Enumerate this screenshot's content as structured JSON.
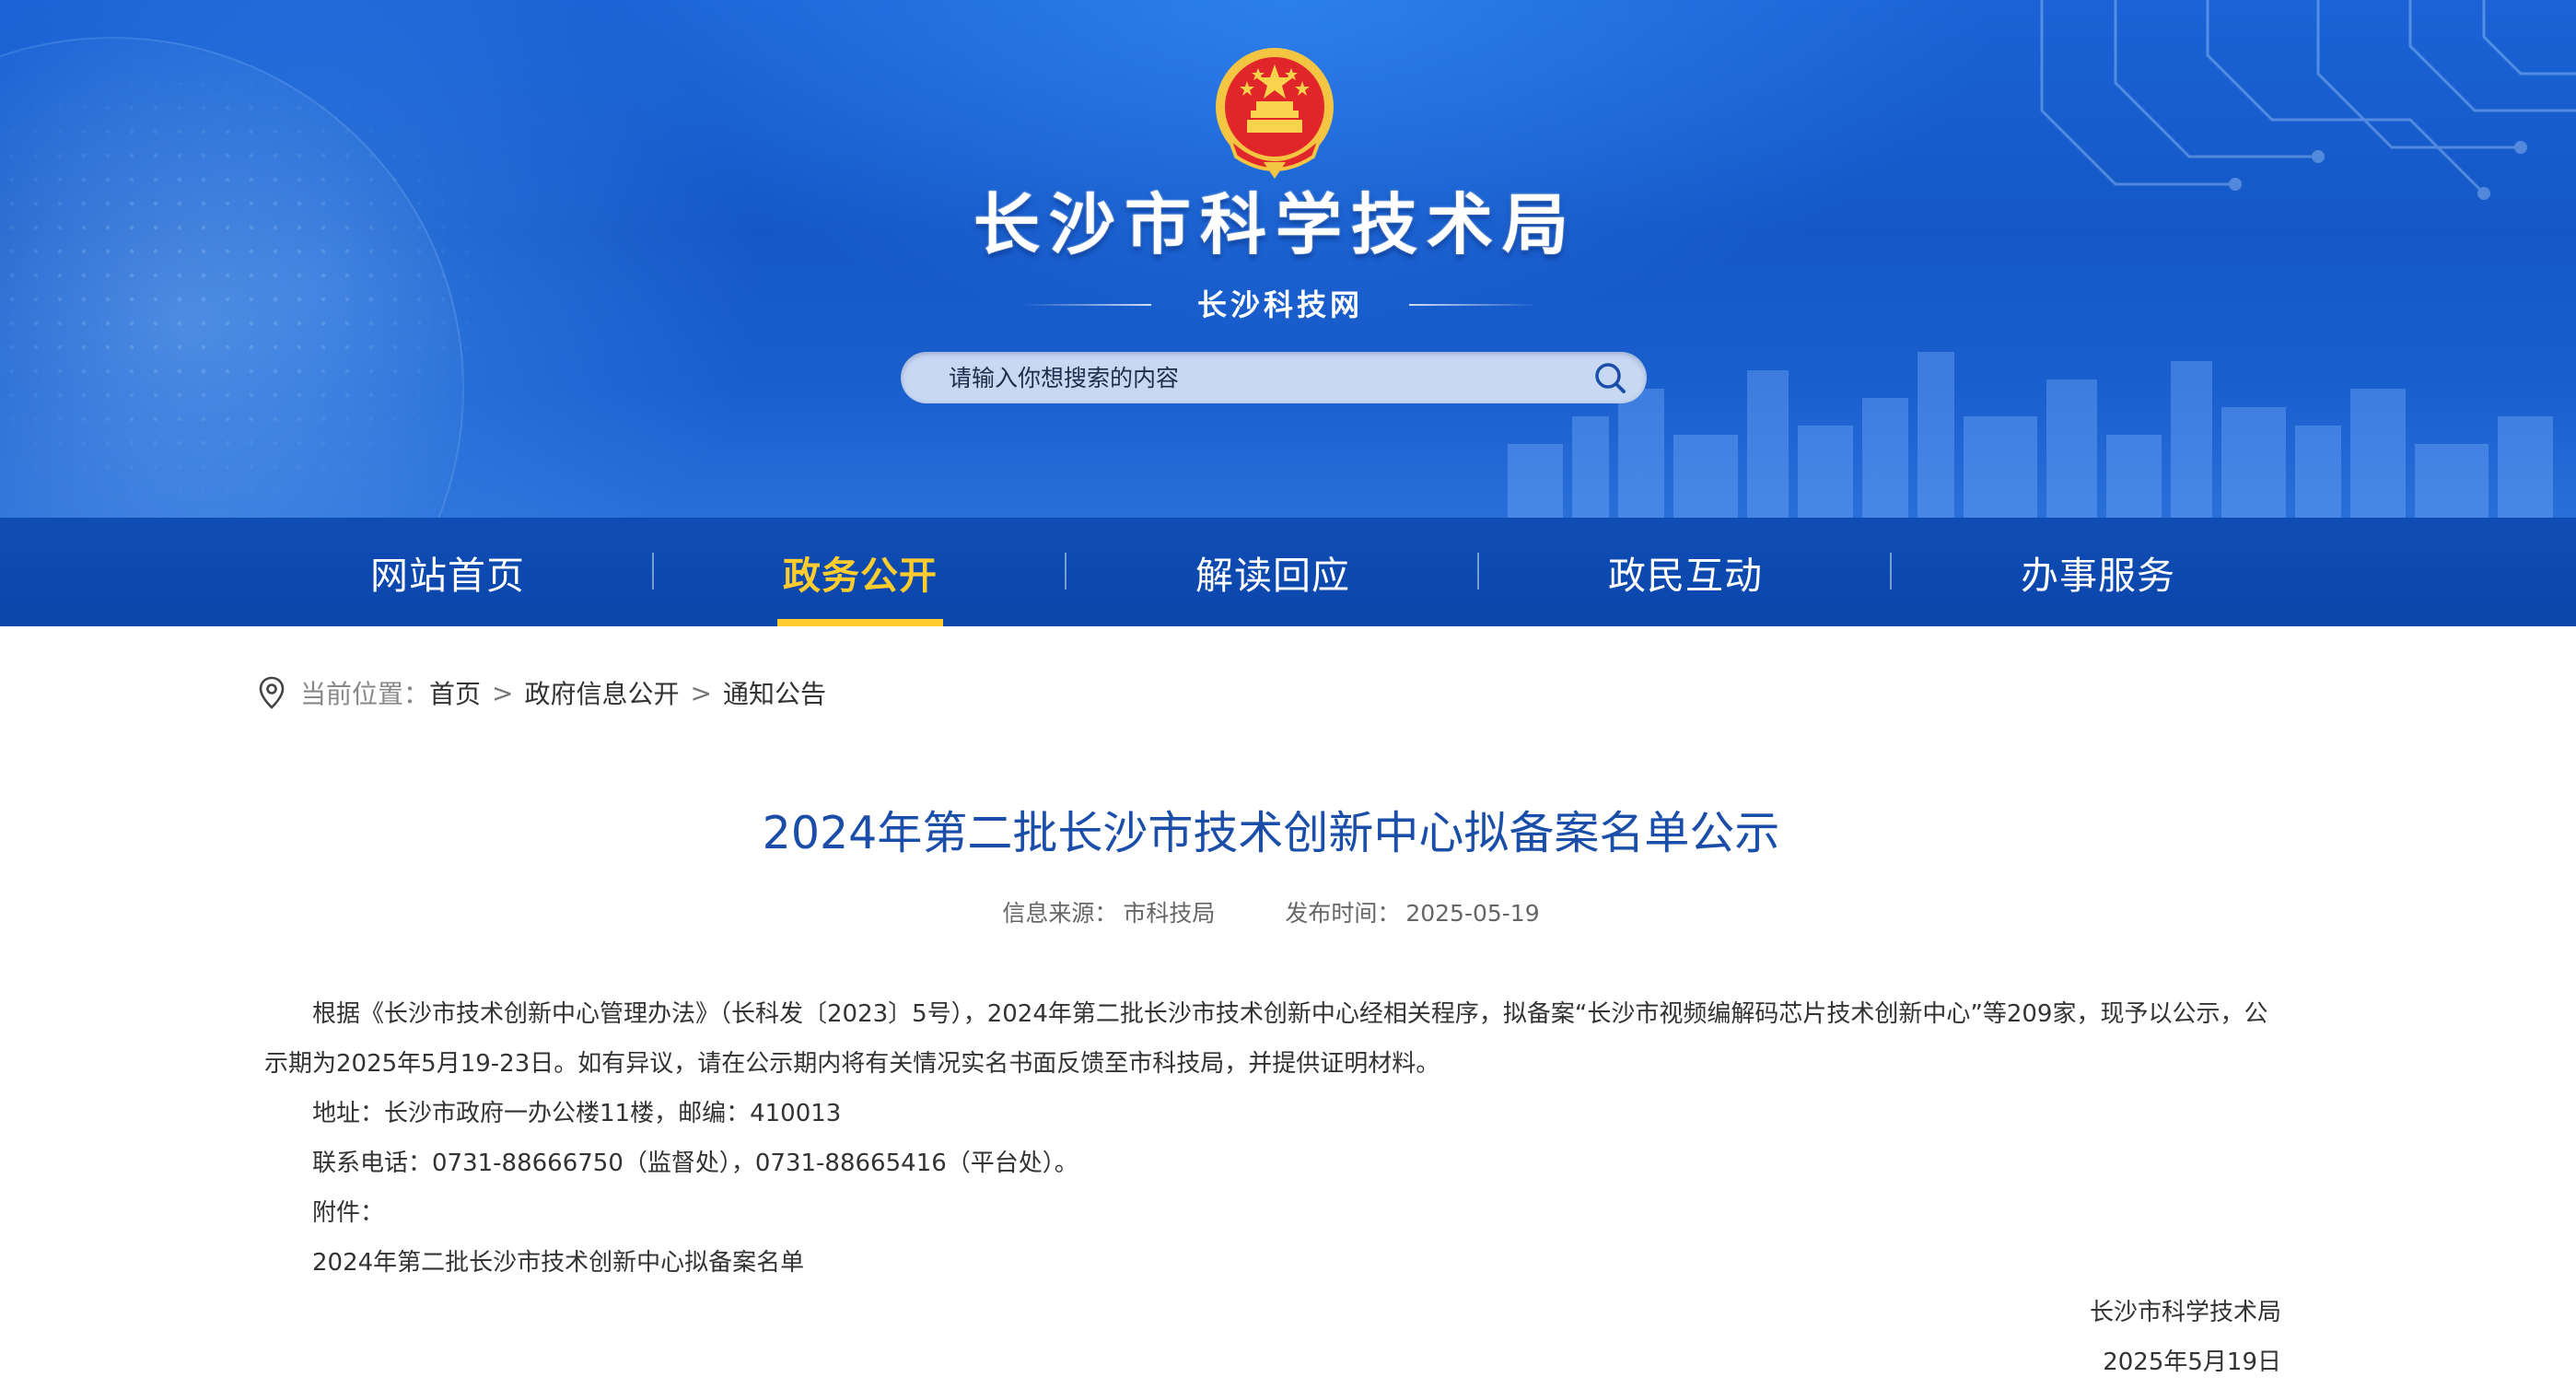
{
  "header": {
    "site_title": "长沙市科学技术局",
    "site_subtitle": "长沙科技网",
    "search_placeholder": "请输入你想搜索的内容",
    "colors": {
      "banner": "#1557c6",
      "nav": "#0b46aa",
      "active": "#ffcc2e",
      "title": "#1a4ea8"
    }
  },
  "nav": {
    "items": [
      {
        "label": "网站首页",
        "active": false
      },
      {
        "label": "政务公开",
        "active": true
      },
      {
        "label": "解读回应",
        "active": false
      },
      {
        "label": "政民互动",
        "active": false
      },
      {
        "label": "办事服务",
        "active": false
      }
    ]
  },
  "breadcrumb": {
    "label": "当前位置：",
    "items": [
      "首页",
      "政府信息公开",
      "通知公告"
    ],
    "separator": ">"
  },
  "article": {
    "title": "2024年第二批长沙市技术创新中心拟备案名单公示",
    "source_label": "信息来源：",
    "source": "市科技局",
    "date_label": "发布时间：",
    "date": "2025-05-19",
    "paragraphs": [
      "根据《长沙市技术创新中心管理办法》（长科发〔2023〕5号），2024年第二批长沙市技术创新中心经相关程序，拟备案“长沙市视频编解码芯片技术创新中心”等209家，现予以公示，公示期为2025年5月19-23日。如有异议，请在公示期内将有关情况实名书面反馈至市科技局，并提供证明材料。",
      "地址：长沙市政府一办公楼11楼，邮编：410013",
      "联系电话：0731-88666750（监督处），0731-88665416（平台处）。",
      "附件："
    ],
    "attachment": "2024年第二批长沙市技术创新中心拟备案名单",
    "signature_org": "长沙市科学技术局",
    "signature_date": "2025年5月19日"
  }
}
